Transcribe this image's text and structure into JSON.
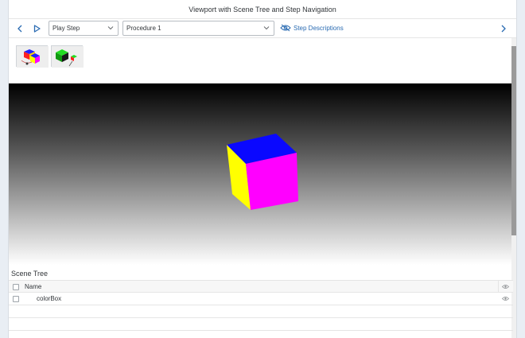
{
  "window": {
    "title": "Viewport with Scene Tree and Step Navigation"
  },
  "toolbar": {
    "prev_icon": "chevron-left-icon",
    "play_icon": "play-icon",
    "play_select": "Play Step",
    "procedure_select": "Procedure 1",
    "step_descriptions_label": "Step Descriptions",
    "step_descriptions_icon": "eye-hidden-icon",
    "next_icon": "chevron-right-icon"
  },
  "thumbnails": [
    {
      "icon": "multi-cube-thumbnail-icon"
    },
    {
      "icon": "green-cube-thumbnail-icon"
    }
  ],
  "viewport": {
    "cube_colors": {
      "top": "#0a08ff",
      "front": "#ff00ff",
      "side": "#ffff00"
    }
  },
  "scene_tree": {
    "title": "Scene Tree",
    "column_name": "Name",
    "rows": [
      {
        "name": "colorBox"
      }
    ]
  },
  "colors": {
    "accent": "#2a6bb2",
    "viewport_top": "#000000",
    "viewport_bottom": "#ffffff"
  }
}
